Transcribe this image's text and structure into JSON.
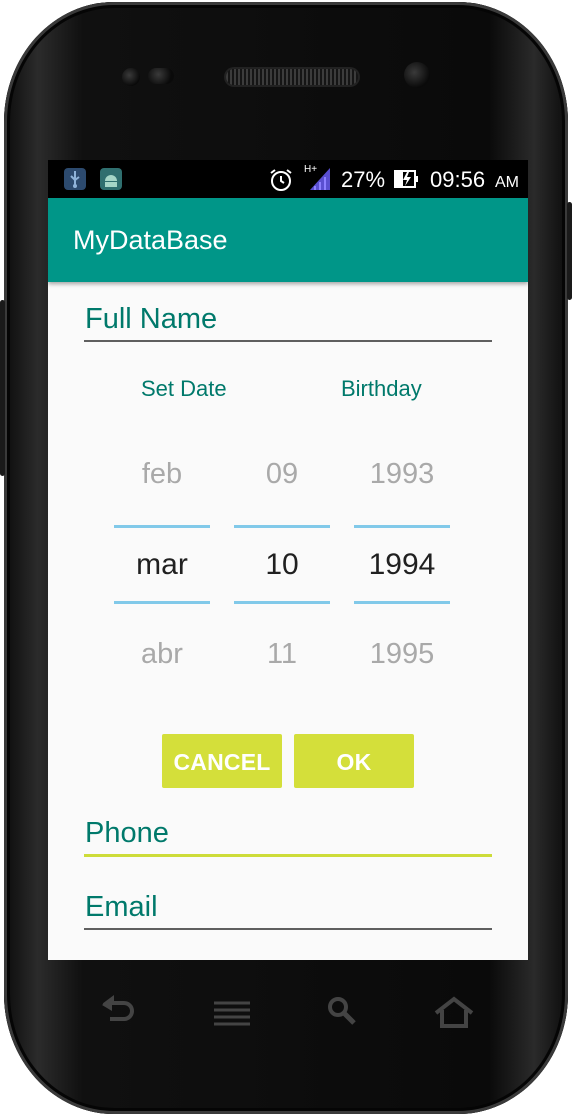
{
  "status_bar": {
    "battery": "27%",
    "time": "09:56",
    "ampm": "AM",
    "network": "H+"
  },
  "app_bar": {
    "title": "MyDataBase"
  },
  "form": {
    "full_name_label": "Full Name",
    "phone_label": "Phone",
    "email_label": "Email"
  },
  "date_picker": {
    "set_date_label": "Set Date",
    "birthday_label": "Birthday",
    "month": {
      "prev": "feb",
      "selected": "mar",
      "next": "abr"
    },
    "day": {
      "prev": "09",
      "selected": "10",
      "next": "11"
    },
    "year": {
      "prev": "1993",
      "selected": "1994",
      "next": "1995"
    },
    "cancel_label": "CANCEL",
    "ok_label": "OK"
  },
  "nav_bar": {
    "icons": [
      "back-icon",
      "menu-icon",
      "search-icon",
      "home-icon"
    ]
  },
  "colors": {
    "primary": "#009688",
    "accent": "#cddc39",
    "picker_divider": "#81c9e9",
    "label_text": "#00796b"
  }
}
